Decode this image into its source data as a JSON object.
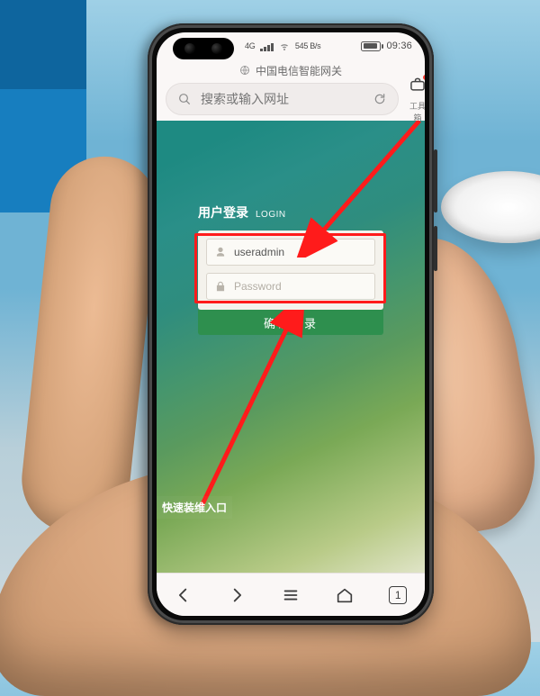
{
  "statusbar": {
    "net_gen": "4G",
    "net_label": "545 B/s",
    "time": "09:36"
  },
  "browser": {
    "title": "中国电信智能网关",
    "search_placeholder": "搜索或输入网址",
    "toolbox_label": "工具箱",
    "tab_count": "1"
  },
  "login": {
    "title_cn": "用户登录",
    "title_en": "LOGIN",
    "username_value": "useradmin",
    "password_placeholder": "Password",
    "submit_label": "确认登录"
  },
  "page": {
    "quick_link": "快速装维入口"
  }
}
